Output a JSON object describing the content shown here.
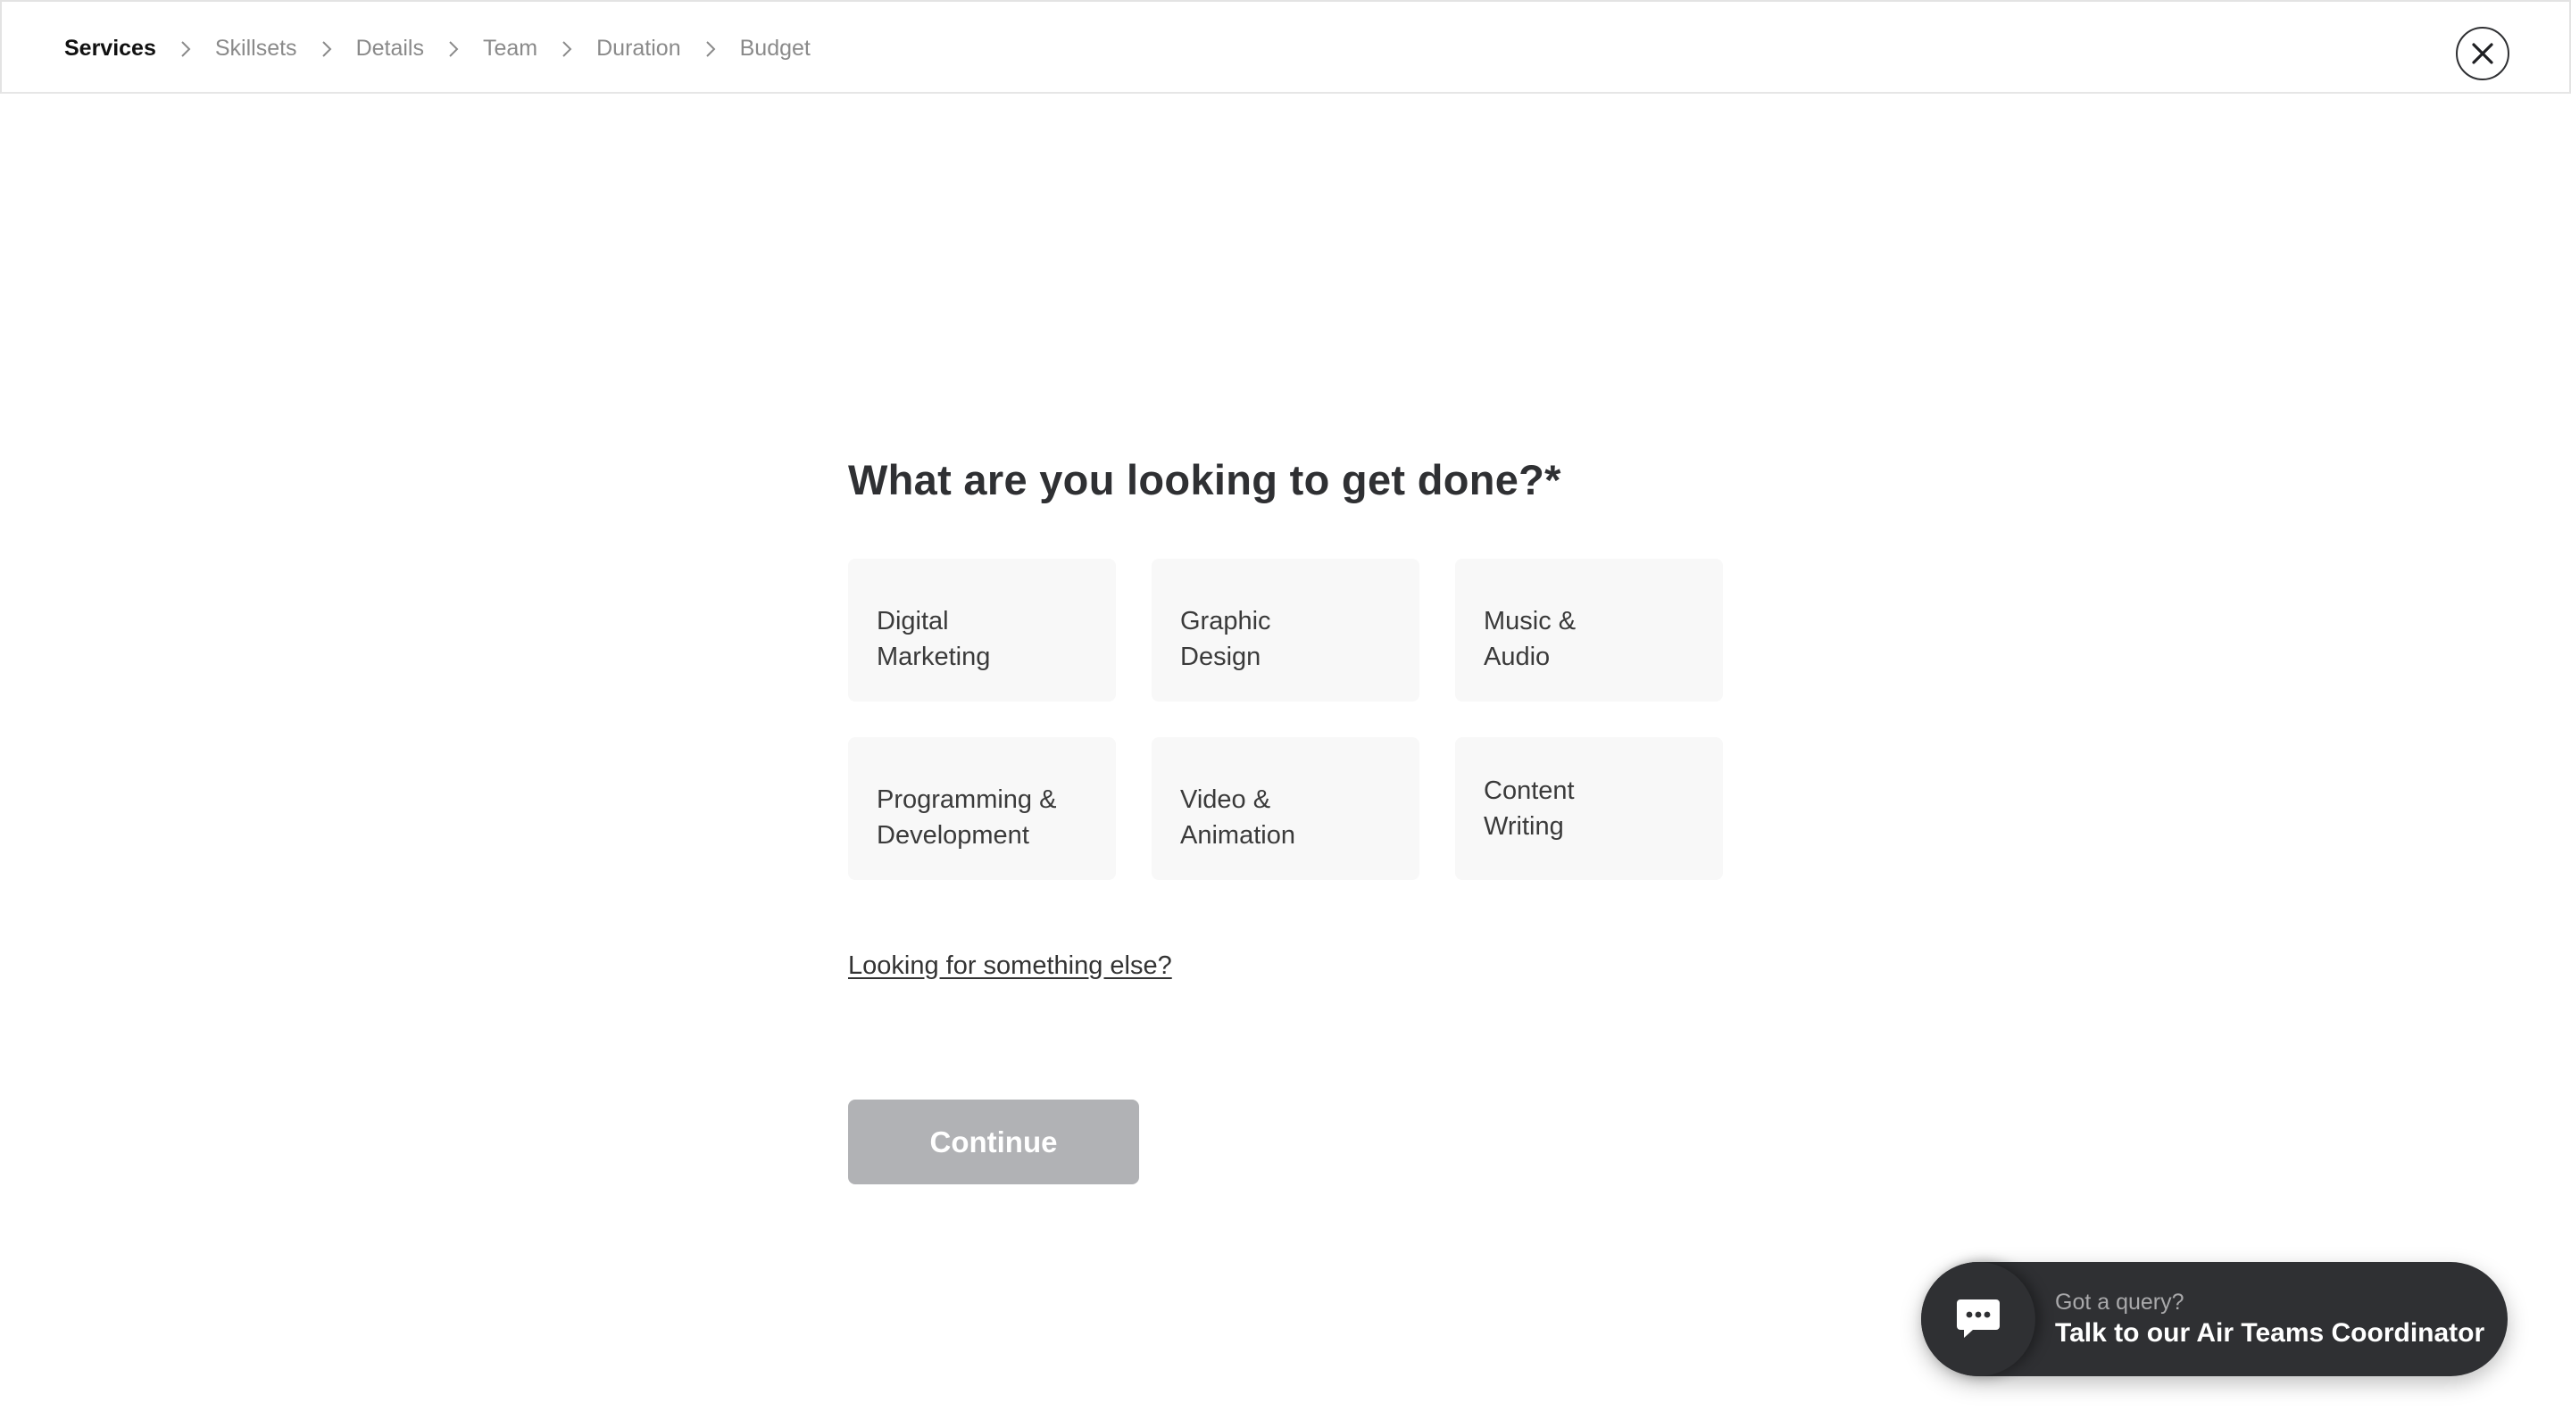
{
  "breadcrumb": {
    "items": [
      {
        "label": "Services",
        "active": true
      },
      {
        "label": "Skillsets",
        "active": false
      },
      {
        "label": "Details",
        "active": false
      },
      {
        "label": "Team",
        "active": false
      },
      {
        "label": "Duration",
        "active": false
      },
      {
        "label": "Budget",
        "active": false
      }
    ],
    "separator_icon": "chevron-right-icon"
  },
  "header": {
    "close_icon": "close-icon"
  },
  "main": {
    "heading": "What are you looking to get done?*",
    "services": [
      {
        "label": "Digital\nMarketing"
      },
      {
        "label": "Graphic\nDesign"
      },
      {
        "label": "Music &\nAudio"
      },
      {
        "label": "Programming &\nDevelopment"
      },
      {
        "label": "Video &\nAnimation"
      },
      {
        "label": "Content\nWriting"
      }
    ],
    "else_link": "Looking for something else?",
    "continue_label": "Continue"
  },
  "chat": {
    "icon": "chat-bubble-icon",
    "subtitle": "Got a query?",
    "title": "Talk to our Air Teams Coordinator"
  },
  "colors": {
    "text_dark": "#2f3033",
    "continue_disabled": "#b1b2b5",
    "card_bg": "#f8f8f8",
    "chat_bg": "#2f3033"
  }
}
